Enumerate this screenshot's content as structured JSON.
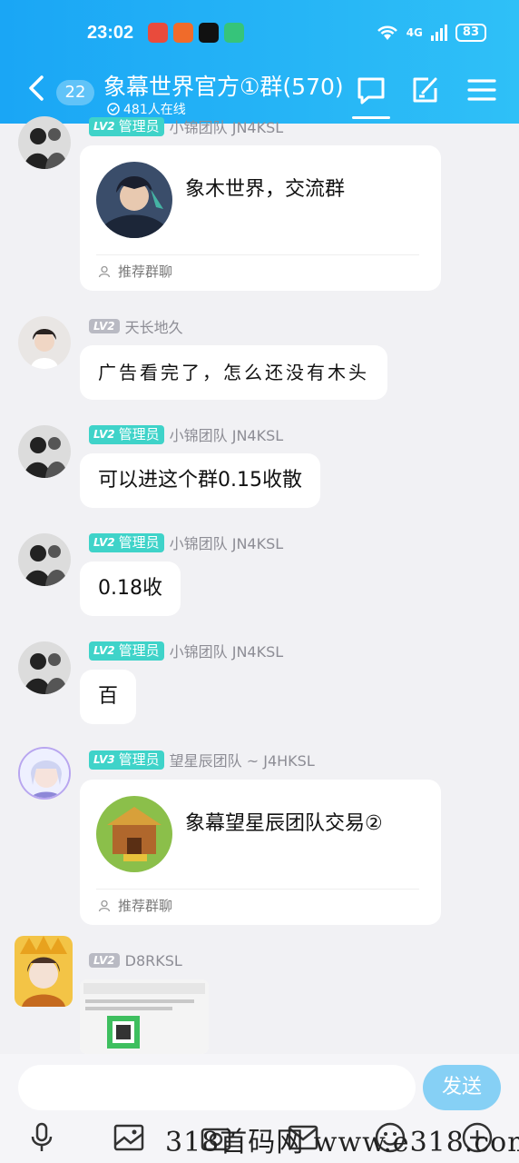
{
  "status": {
    "time": "23:02",
    "network": "4G",
    "battery": "83"
  },
  "header": {
    "unread_count": "22",
    "title": "象幕世界官方①群(570)",
    "subtitle": "481人在线",
    "icons": [
      "chat-icon",
      "edit-note-icon",
      "menu-icon"
    ]
  },
  "messages": [
    {
      "lv": "LV2",
      "role": "管理员",
      "sender": "小锦团队  JN4KSL",
      "type": "card",
      "card_name": "象木世界，交流群",
      "card_footer": "推荐群聊"
    },
    {
      "lv": "LV2",
      "sender": "天长地久",
      "type": "text",
      "text": "广告看完了，怎么还没有木头"
    },
    {
      "lv": "LV2",
      "role": "管理员",
      "sender": "小锦团队  JN4KSL",
      "type": "text",
      "text": "可以进这个群0.15收散"
    },
    {
      "lv": "LV2",
      "role": "管理员",
      "sender": "小锦团队  JN4KSL",
      "type": "text",
      "text": "0.18收"
    },
    {
      "lv": "LV2",
      "role": "管理员",
      "sender": "小锦团队  JN4KSL",
      "type": "text",
      "text": "百"
    },
    {
      "lv": "LV3",
      "role": "管理员",
      "sender": "望星辰团队 ~ J4HKSL",
      "type": "card",
      "card_name": "象幕望星辰团队交易②",
      "card_footer": "推荐群聊"
    },
    {
      "lv": "LV2",
      "sender": "D8RKSL",
      "type": "image"
    }
  ],
  "input": {
    "placeholder": "",
    "send_label": "发送"
  },
  "toolbar": [
    "microphone-icon",
    "image-icon",
    "camera-icon",
    "envelope-icon",
    "emoji-icon",
    "plus-icon"
  ],
  "watermark": "318首码网  www.e318.com",
  "colors": {
    "header": "#1aa6f5",
    "admin_badge": "#3fd3c9",
    "send_button": "#86d0f5"
  }
}
